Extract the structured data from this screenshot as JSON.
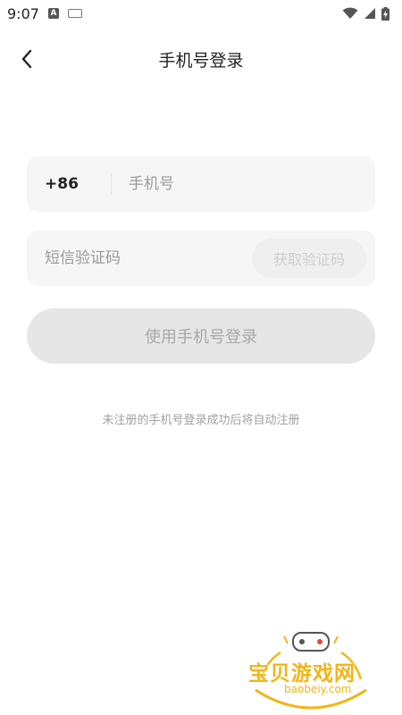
{
  "status_bar": {
    "time": "9:07",
    "icons": [
      "a-notification-icon",
      "keyboard-icon",
      "wifi-icon",
      "signal-icon",
      "battery-charging-icon"
    ]
  },
  "header": {
    "title": "手机号登录",
    "back_icon": "chevron-left-icon"
  },
  "form": {
    "country_code": "+86",
    "phone_placeholder": "手机号",
    "phone_value": "",
    "code_placeholder": "短信验证码",
    "code_value": "",
    "get_code_label": "获取验证码",
    "login_label": "使用手机号登录",
    "notice": "未注册的手机号登录成功后将自动注册"
  },
  "watermark": {
    "title": "宝贝游戏网",
    "url": "baobeiy.com"
  },
  "colors": {
    "background": "#ffffff",
    "field_bg": "#f6f6f6",
    "button_disabled_bg": "#e6e6e6",
    "button_disabled_text": "#a8a8a8",
    "watermark_yellow": "#f3b515"
  }
}
